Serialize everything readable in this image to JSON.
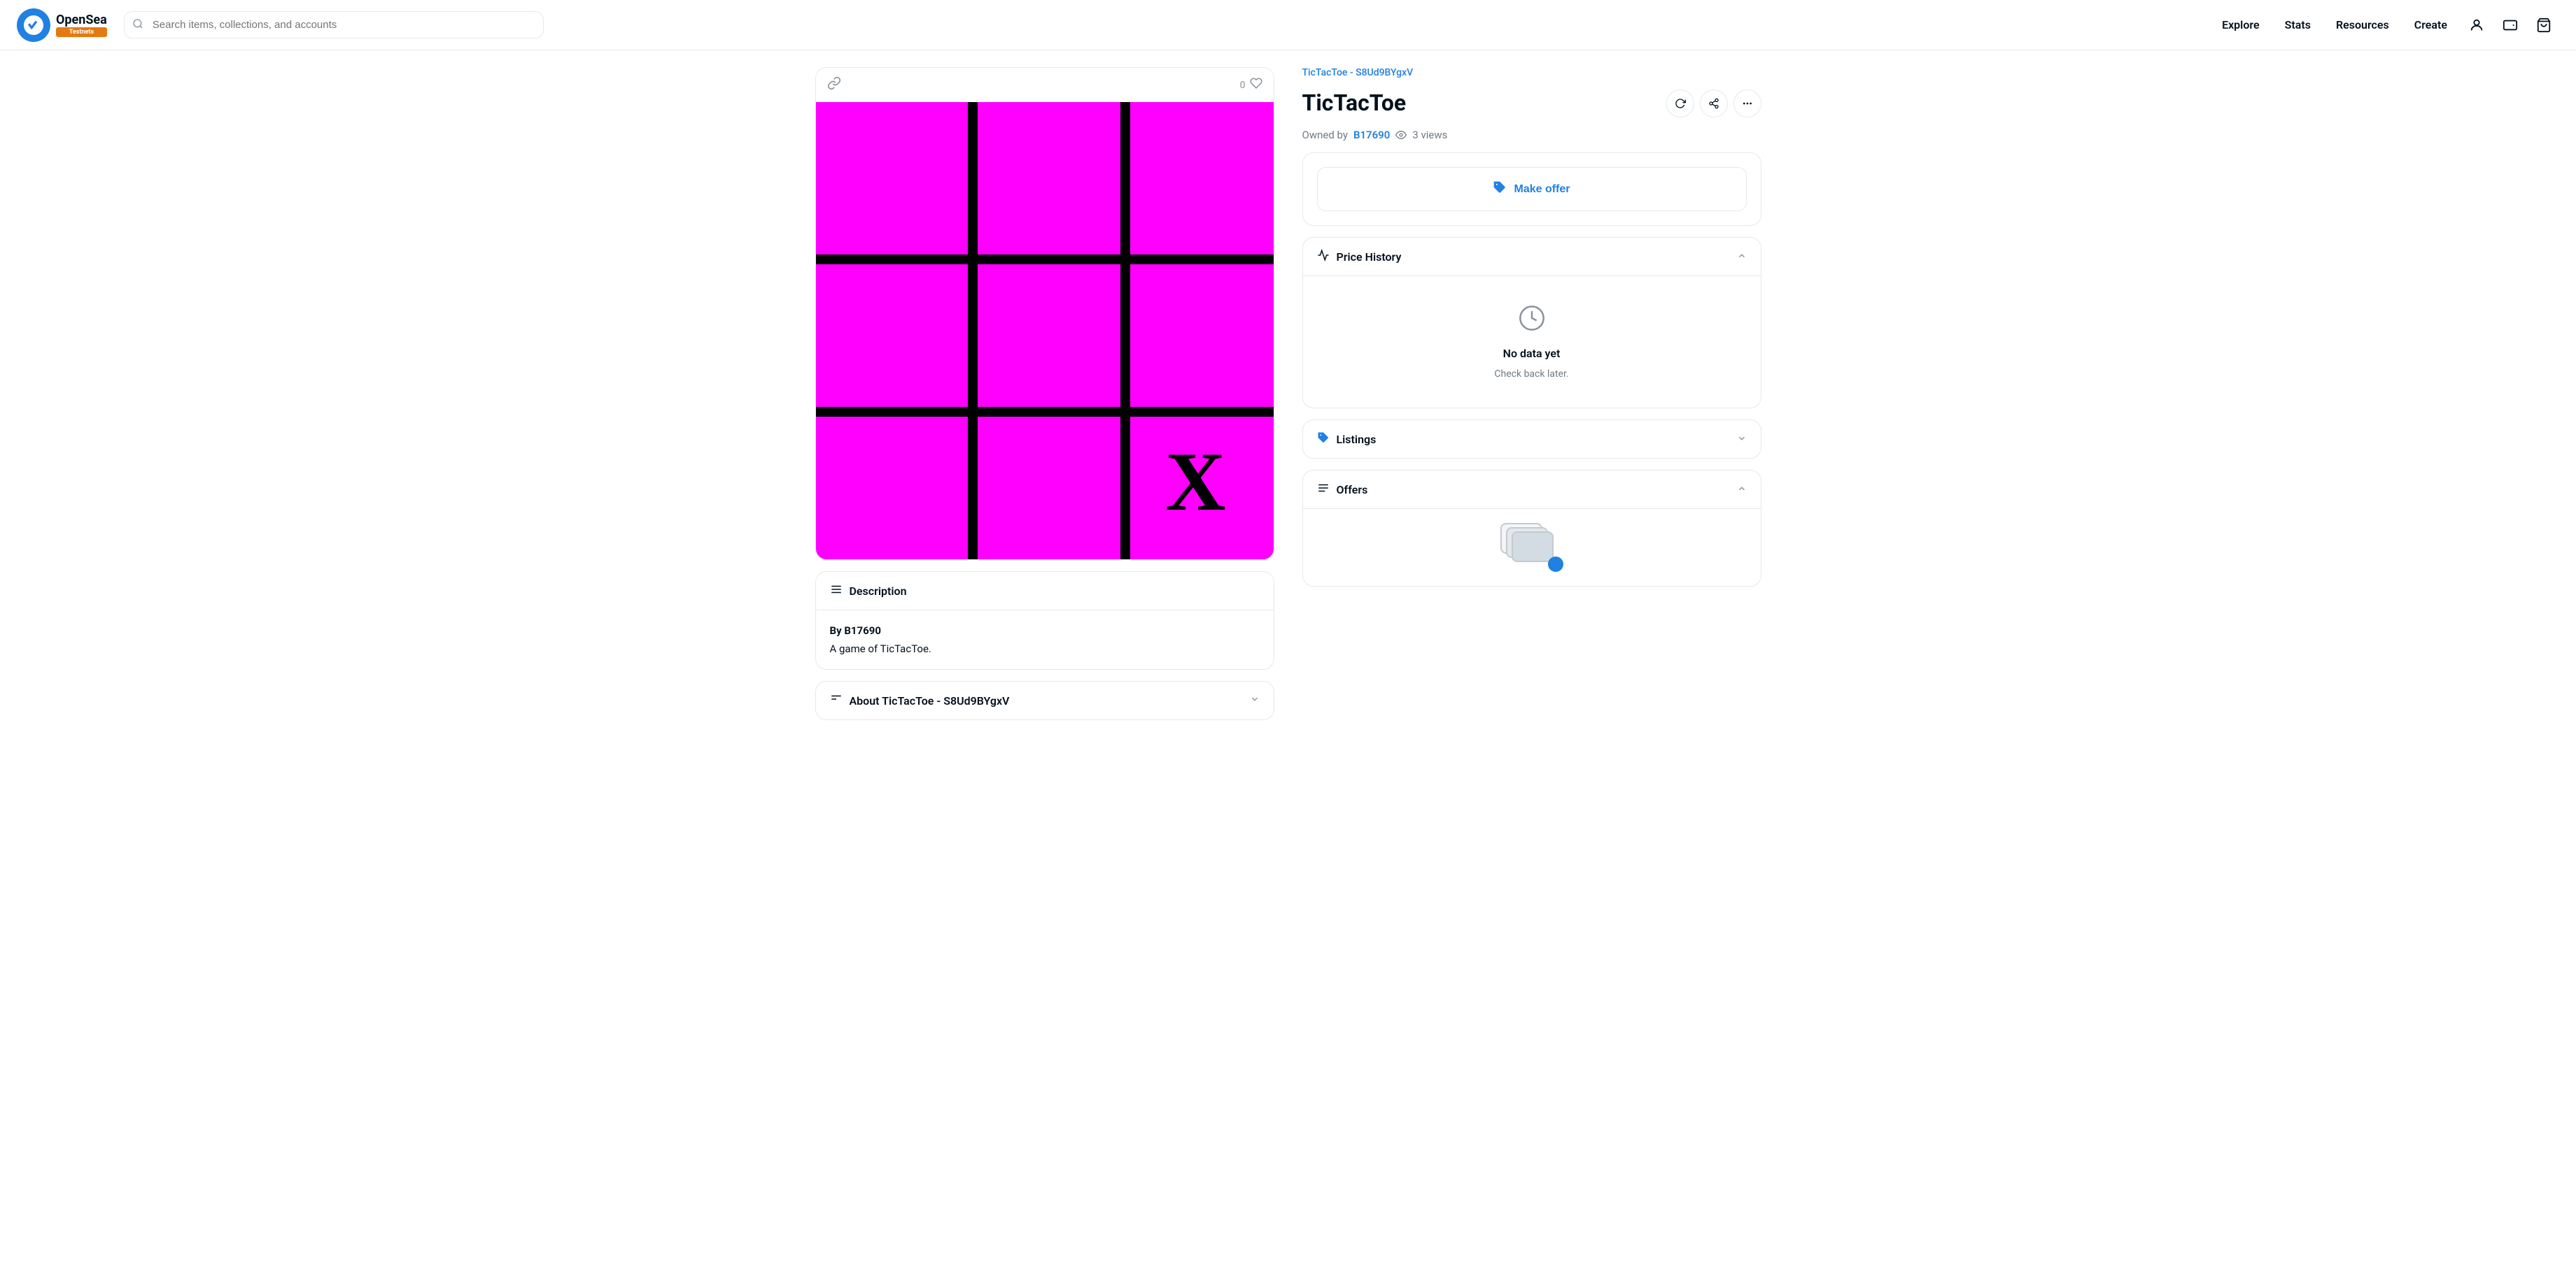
{
  "site": {
    "logo_alt": "OpenSea",
    "logo_badge": "Testnets",
    "search_placeholder": "Search items, collections, and accounts"
  },
  "navbar": {
    "links": [
      "Explore",
      "Stats",
      "Resources",
      "Create"
    ]
  },
  "breadcrumb": "TicTacToe - S8Ud9BYgxV",
  "nft": {
    "title": "TicTacToe",
    "owned_by_label": "Owned by",
    "owner": "B17690",
    "views_count": "3",
    "views_label": "views",
    "like_count": "0"
  },
  "actions": {
    "make_offer_label": "Make offer",
    "refresh_label": "Refresh",
    "share_label": "Share",
    "more_label": "More"
  },
  "price_history": {
    "title": "Price History",
    "no_data_title": "No data yet",
    "no_data_sub": "Check back later."
  },
  "description": {
    "title": "Description",
    "by_label": "By",
    "author": "B17690",
    "text": "A game of TicTacToe."
  },
  "about": {
    "title": "About TicTacToe - S8Ud9BYgxV"
  },
  "listings": {
    "title": "Listings"
  },
  "offers": {
    "title": "Offers"
  },
  "icons": {
    "chain": "⬡",
    "heart": "♡",
    "description_lines": "☰",
    "about_lines": "☰",
    "offers_lines": "☰",
    "trending": "∿",
    "tag": "🏷",
    "clock": "🕐",
    "eye": "👁",
    "chevron_down": "∨",
    "chevron_up": "∧",
    "refresh": "↻",
    "share": "⬆",
    "more": "⋯"
  }
}
